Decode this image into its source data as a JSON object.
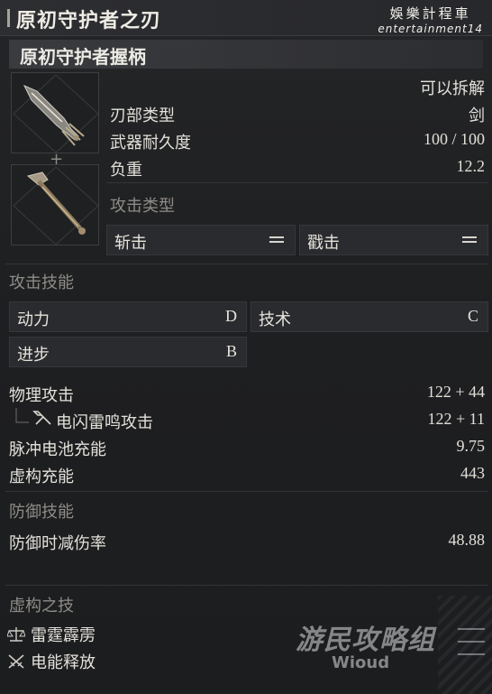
{
  "header": {
    "title": "原初守护者之刃",
    "watermark_line1": "娛樂計程車",
    "watermark_line2": "entertainment14"
  },
  "subtitle": "原初守护者握柄",
  "disassemble": "可以拆解",
  "stats": {
    "blade_type_label": "刃部类型",
    "blade_type_value": "剑",
    "durability_label": "武器耐久度",
    "durability_value": "100 / 100",
    "weight_label": "负重",
    "weight_value": "12.2"
  },
  "attack_type": {
    "title": "攻击类型",
    "items": [
      {
        "label": "斩击"
      },
      {
        "label": "戳击"
      }
    ]
  },
  "attack_skills": {
    "title": "攻击技能",
    "items": [
      {
        "label": "动力",
        "grade": "D"
      },
      {
        "label": "技术",
        "grade": "C"
      },
      {
        "label": "进步",
        "grade": "B"
      }
    ]
  },
  "attack": {
    "physical_label": "物理攻击",
    "physical_value": "122 + 44",
    "sub_label": "电闪雷鸣攻击",
    "sub_value": "122 + 11",
    "pulse_label": "脉冲电池充能",
    "pulse_value": "9.75",
    "fable_label": "虚构充能",
    "fable_value": "443"
  },
  "defense_skills": {
    "title": "防御技能",
    "guard_label": "防御时减伤率",
    "guard_value": "48.88"
  },
  "fable_arts": {
    "title": "虚构之技",
    "items": [
      {
        "label": "雷霆霹雳",
        "icon": "scales-icon"
      },
      {
        "label": "电能释放",
        "icon": "crossed-swords-icon"
      }
    ]
  },
  "watermark_bottom": {
    "big": "游民攻略组",
    "small": "Wioud"
  }
}
